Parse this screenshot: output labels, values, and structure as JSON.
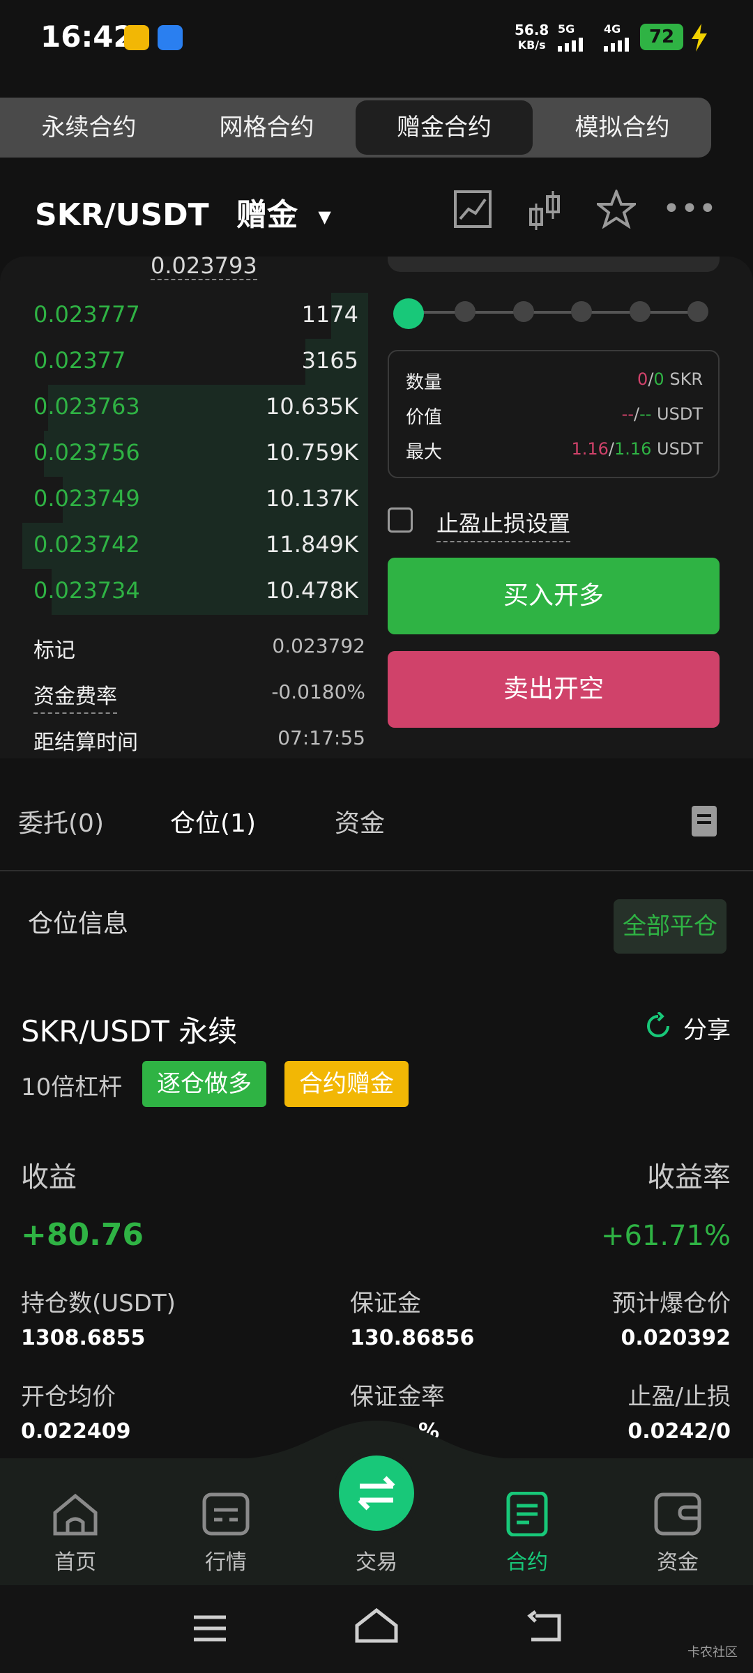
{
  "status": {
    "time": "16:42",
    "net_speed": "56.8",
    "net_unit": "KB/s",
    "sig1": "5G",
    "sig2": "4G",
    "battery": "72"
  },
  "tabs": [
    {
      "label": "永续合约"
    },
    {
      "label": "网格合约"
    },
    {
      "label": "赠金合约",
      "active": true
    },
    {
      "label": "模拟合约"
    }
  ],
  "header": {
    "pair": "SKR/USDT",
    "mode": "赠金"
  },
  "orderbook": {
    "top_price": "0.023793",
    "rows": [
      {
        "price": "0.023777",
        "qty": "1174",
        "depth": 0.1
      },
      {
        "price": "0.02377",
        "qty": "3165",
        "depth": 0.17
      },
      {
        "price": "0.023763",
        "qty": "10.635K",
        "depth": 0.87
      },
      {
        "price": "0.023756",
        "qty": "10.759K",
        "depth": 0.88
      },
      {
        "price": "0.023749",
        "qty": "10.137K",
        "depth": 0.83
      },
      {
        "price": "0.023742",
        "qty": "11.849K",
        "depth": 0.94
      },
      {
        "price": "0.023734",
        "qty": "10.478K",
        "depth": 0.86
      }
    ],
    "mark_label": "标记",
    "mark_value": "0.023792",
    "funding_label": "资金费率",
    "funding_value": "-0.0180%",
    "settle_label": "距结算时间",
    "settle_value": "07:17:55"
  },
  "order_form": {
    "qty_label": "数量",
    "qty_a": "0",
    "qty_b": "0",
    "qty_unit": "SKR",
    "value_label": "价值",
    "value_a": "--",
    "value_b": "--",
    "value_unit": "USDT",
    "max_label": "最大",
    "max_a": "1.16",
    "max_b": "1.16",
    "max_unit": "USDT",
    "tp_sl_label": "止盈止损设置",
    "buy_label": "买入开多",
    "sell_label": "卖出开空"
  },
  "bottom_tabs": {
    "orders": "委托(0)",
    "positions": "仓位(1)",
    "funds": "资金"
  },
  "position_header": {
    "title": "仓位信息",
    "close_all": "全部平仓"
  },
  "position": {
    "symbol": "SKR/USDT 永续",
    "share": "分享",
    "leverage": "10倍杠杆",
    "tag_side": "逐仓做多",
    "tag_bonus": "合约赠金",
    "pnl_label": "收益",
    "pnl_value": "+80.76",
    "roe_label": "收益率",
    "roe_value": "+61.71%",
    "size_label": "持仓数(USDT)",
    "size_value": "1308.6855",
    "margin_label": "保证金",
    "margin_value": "130.86856",
    "liq_label": "预计爆仓价",
    "liq_value": "0.020392",
    "entry_label": "开仓均价",
    "entry_value": "0.022409",
    "margin_rate_label": "保证金率",
    "margin_rate_value": "%",
    "tpsl_label": "止盈/止损",
    "tpsl_value": "0.0242/0"
  },
  "nav": [
    {
      "label": "首页"
    },
    {
      "label": "行情"
    },
    {
      "label": "交易"
    },
    {
      "label": "合约",
      "active": true
    },
    {
      "label": "资金"
    }
  ],
  "watermark": "卡农社区",
  "colors": {
    "green": "#2fb344",
    "teal": "#18c879",
    "red": "#d0426a",
    "yellow": "#f2b705",
    "bg": "#121212"
  }
}
